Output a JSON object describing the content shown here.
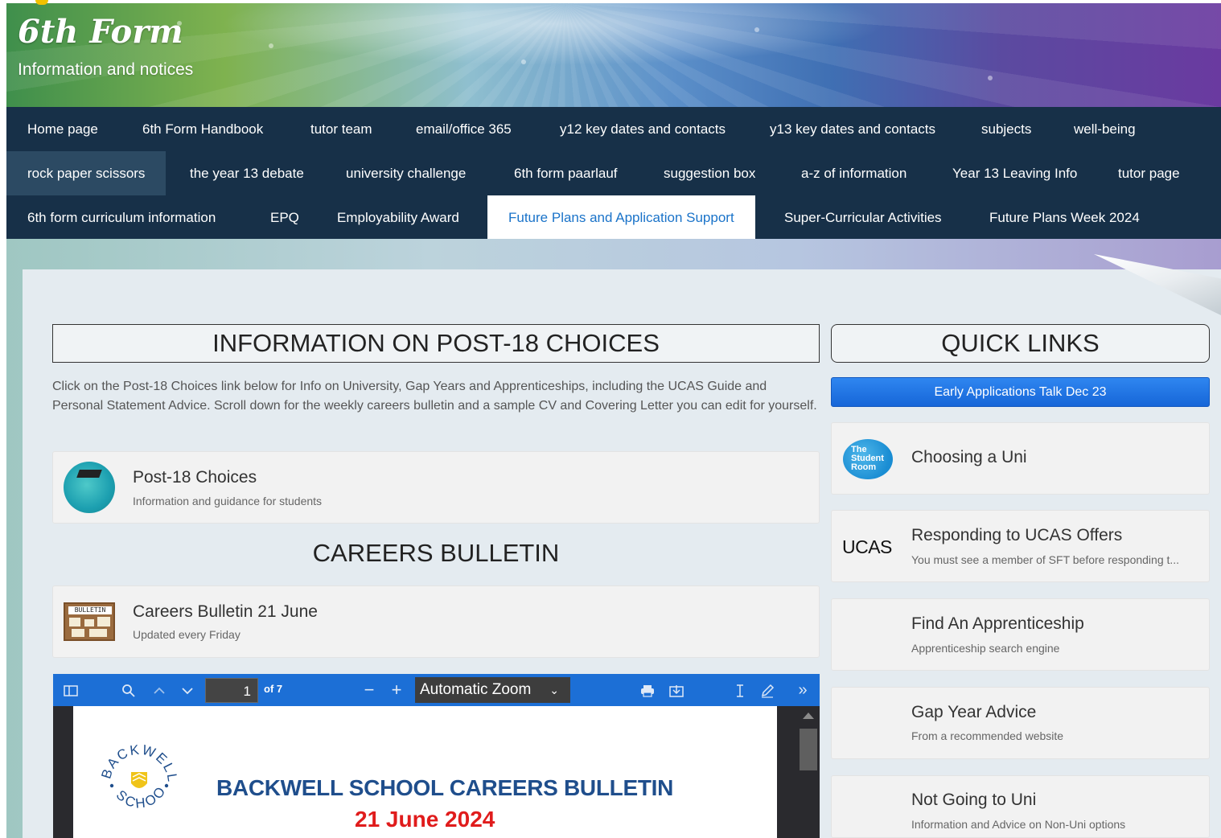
{
  "header": {
    "site_title": "6th Form",
    "site_subtitle": "Information and notices"
  },
  "nav": {
    "row1": [
      "Home page",
      "6th Form Handbook",
      "tutor team",
      "email/office 365",
      "y12 key dates and contacts",
      "y13 key dates and contacts",
      "subjects",
      "well-being"
    ],
    "row2": [
      "rock paper scissors",
      "the year 13 debate",
      "university challenge",
      "6th form paarlauf",
      "suggestion box",
      "a-z of information",
      "Year 13 Leaving Info",
      "tutor page"
    ],
    "row3": [
      "6th form curriculum information",
      "EPQ",
      "Employability Award",
      "Future Plans and Application Support",
      "Super-Curricular Activities",
      "Future Plans Week 2024"
    ],
    "active": "Future Plans and Application Support",
    "highlighted": "rock paper scissors"
  },
  "main": {
    "section_heading": "INFORMATION ON POST-18 CHOICES",
    "intro": "Click on the Post-18 Choices link below for Info on University, Gap Years and Apprenticeships, including the UCAS Guide and Personal Statement Advice. Scroll down for the weekly careers bulletin and a sample CV and Covering Letter you can edit for yourself.",
    "post18_card": {
      "title": "Post-18 Choices",
      "subtitle": "Information and guidance for students"
    },
    "bulletin_heading": "CAREERS BULLETIN",
    "bulletin_card": {
      "title": "Careers Bulletin 21 June",
      "subtitle": "Updated every Friday",
      "thumb_label": "BULLETIN"
    }
  },
  "pdf_viewer": {
    "page_number": "1",
    "page_count": "of 7",
    "zoom": "Automatic Zoom",
    "doc_title": "BACKWELL SCHOOL CAREERS BULLETIN",
    "doc_date": "21 June 2024",
    "crest_top": "BACKWELL",
    "crest_bottom": "SCHOOL"
  },
  "quick_links": {
    "heading": "QUICK LINKS",
    "button": "Early Applications Talk Dec 23",
    "items": [
      {
        "title": "Choosing a Uni",
        "subtitle": "",
        "logo": "The Student Room"
      },
      {
        "title": "Responding to UCAS Offers",
        "subtitle": "You must see a member of SFT before responding t...",
        "logo": "UCAS"
      },
      {
        "title": "Find An Apprenticeship",
        "subtitle": "Apprenticeship search engine",
        "logo": ""
      },
      {
        "title": "Gap Year Advice",
        "subtitle": "From a recommended website",
        "logo": ""
      },
      {
        "title": "Not Going to Uni",
        "subtitle": "Information and Advice on Non-Uni options",
        "logo": ""
      }
    ]
  },
  "colors": {
    "nav_bg": "#173048",
    "active_link": "#1a73c9",
    "pdf_toolbar": "#1c6fd6",
    "doc_title": "#1f4e8c",
    "doc_date": "#e01c1c"
  }
}
